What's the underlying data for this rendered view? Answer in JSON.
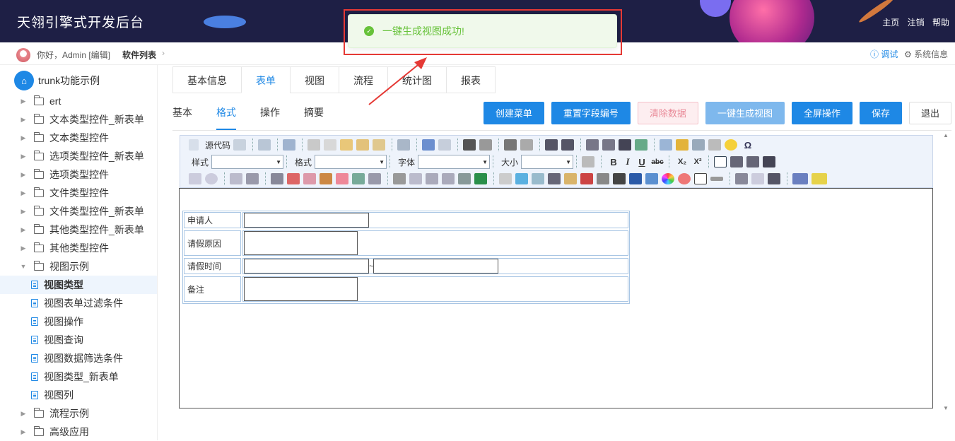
{
  "header": {
    "title": "天翎引擎式开发后台",
    "nav": [
      "主页",
      "注销",
      "帮助"
    ]
  },
  "subbar": {
    "greeting": "你好，Admin [编辑]",
    "breadcrumb": "软件列表",
    "debug": "调试",
    "sysinfo": "系统信息"
  },
  "sidebar": {
    "root": "trunk功能示例",
    "items": [
      {
        "label": "ert",
        "type": "folder"
      },
      {
        "label": "文本类型控件_新表单",
        "type": "folder"
      },
      {
        "label": "文本类型控件",
        "type": "folder"
      },
      {
        "label": "选项类型控件_新表单",
        "type": "folder"
      },
      {
        "label": "选项类型控件",
        "type": "folder"
      },
      {
        "label": "文件类型控件",
        "type": "folder"
      },
      {
        "label": "文件类型控件_新表单",
        "type": "folder"
      },
      {
        "label": "其他类型控件_新表单",
        "type": "folder"
      },
      {
        "label": "其他类型控件",
        "type": "folder"
      },
      {
        "label": "视图示例",
        "type": "folder-open"
      },
      {
        "label": "视图类型",
        "type": "doc",
        "selected": true
      },
      {
        "label": "视图表单过滤条件",
        "type": "doc"
      },
      {
        "label": "视图操作",
        "type": "doc"
      },
      {
        "label": "视图查询",
        "type": "doc"
      },
      {
        "label": "视图数据筛选条件",
        "type": "doc"
      },
      {
        "label": "视图类型_新表单",
        "type": "doc"
      },
      {
        "label": "视图列",
        "type": "doc"
      },
      {
        "label": "流程示例",
        "type": "folder"
      },
      {
        "label": "高级应用",
        "type": "folder"
      }
    ]
  },
  "tabs": [
    "基本信息",
    "表单",
    "视图",
    "流程",
    "统计图",
    "报表"
  ],
  "subtabs": [
    "基本",
    "格式",
    "操作",
    "摘要"
  ],
  "buttons": {
    "create_menu": "创建菜单",
    "reset_fields": "重置字段编号",
    "clear_data": "清除数据",
    "gen_view": "一键生成视图",
    "fullscreen": "全屏操作",
    "save": "保存",
    "exit": "退出"
  },
  "toolbar": {
    "source": "源代码",
    "style": "样式",
    "format": "格式",
    "font": "字体",
    "size": "大小",
    "bold": "B",
    "italic": "I",
    "underline": "U",
    "strike": "abc",
    "sub": "X₂",
    "sup": "X²",
    "omega": "Ω"
  },
  "form": {
    "rows": [
      {
        "label": "申请人"
      },
      {
        "label": "请假原因"
      },
      {
        "label": "请假时间",
        "sep": "~"
      },
      {
        "label": "备注"
      }
    ]
  },
  "toast": {
    "message": "一键生成视图成功!"
  }
}
